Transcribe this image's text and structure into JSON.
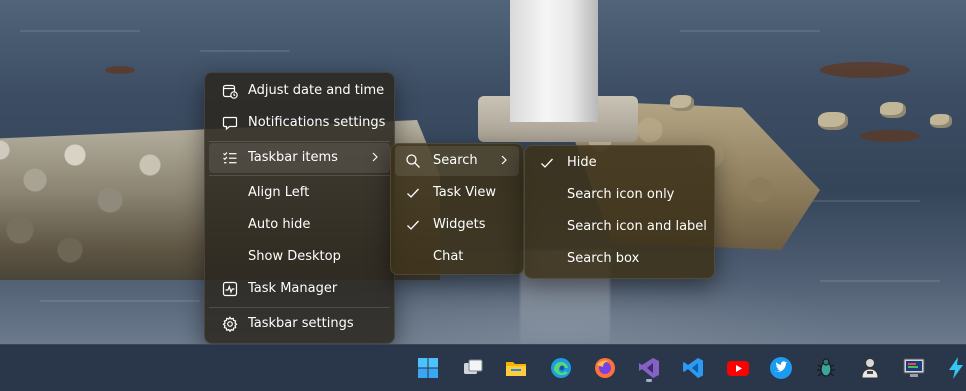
{
  "main_menu": {
    "items": [
      {
        "label": "Adjust date and time",
        "icon": "calendar-clock-icon"
      },
      {
        "label": "Notifications settings",
        "icon": "chat-bubble-icon"
      },
      {
        "label": "Taskbar items",
        "icon": "checklist-icon",
        "submenu": true
      },
      {
        "label": "Align Left"
      },
      {
        "label": "Auto hide"
      },
      {
        "label": "Show Desktop"
      },
      {
        "label": "Task Manager",
        "icon": "activity-monitor-icon"
      },
      {
        "label": "Taskbar settings",
        "icon": "gear-icon"
      }
    ]
  },
  "taskbar_items_menu": {
    "items": [
      {
        "label": "Search",
        "icon": "search-icon",
        "submenu": true
      },
      {
        "label": "Task View",
        "checked": true
      },
      {
        "label": "Widgets",
        "checked": true
      },
      {
        "label": "Chat",
        "checked": false
      }
    ]
  },
  "search_menu": {
    "items": [
      {
        "label": "Hide",
        "checked": true
      },
      {
        "label": "Search icon only",
        "checked": false
      },
      {
        "label": "Search icon and label",
        "checked": false
      },
      {
        "label": "Search box",
        "checked": false
      }
    ]
  },
  "taskbar": {
    "apps": [
      {
        "name": "start-button",
        "icon": "windows-logo-icon"
      },
      {
        "name": "task-view-button",
        "icon": "task-view-icon"
      },
      {
        "name": "file-explorer-button",
        "icon": "folder-icon"
      },
      {
        "name": "edge-button",
        "icon": "edge-icon"
      },
      {
        "name": "firefox-button",
        "icon": "firefox-icon"
      },
      {
        "name": "visual-studio-button",
        "icon": "visual-studio-icon",
        "running": true
      },
      {
        "name": "vscode-button",
        "icon": "vscode-icon"
      },
      {
        "name": "youtube-button",
        "icon": "youtube-icon"
      },
      {
        "name": "twitter-button",
        "icon": "twitter-icon"
      },
      {
        "name": "bug-app-button",
        "icon": "bug-icon"
      },
      {
        "name": "user-app-button",
        "icon": "user-figure-icon"
      },
      {
        "name": "terminal-app-button",
        "icon": "computer-icon"
      },
      {
        "name": "power-app-button",
        "icon": "lightning-icon"
      }
    ]
  },
  "colors": {
    "menu_bg": "#2c2820",
    "submenu_bg": "#3c321a",
    "taskbar_bg": "#2a364a",
    "accent": "#0078d4"
  }
}
